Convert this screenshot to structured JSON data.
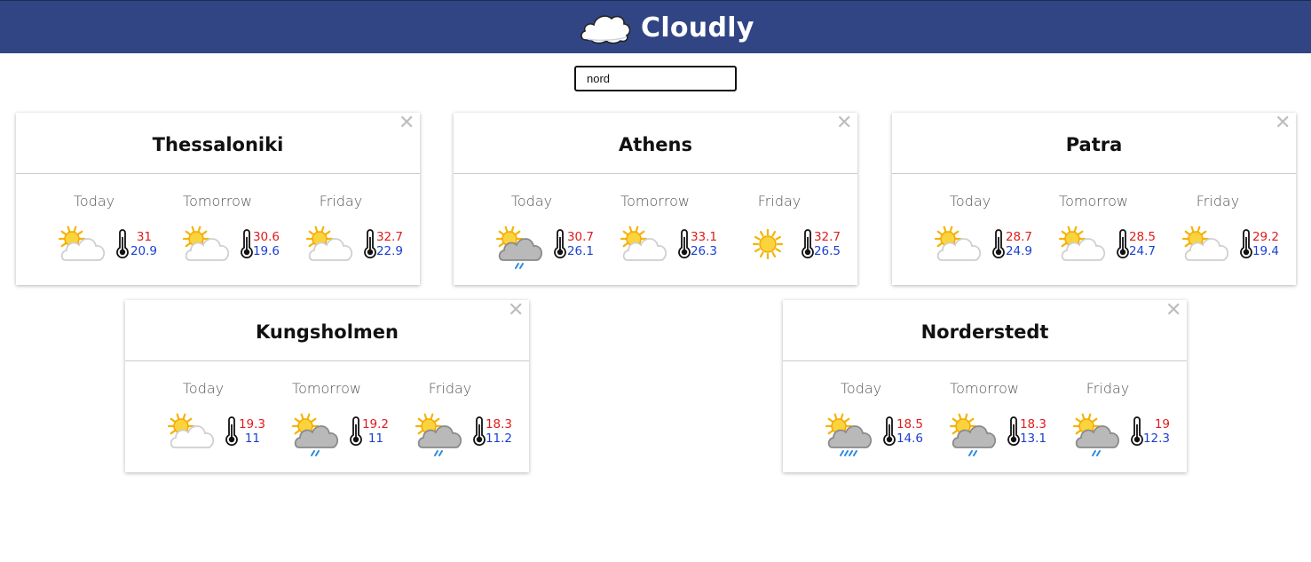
{
  "app": {
    "title": "Cloudly"
  },
  "search": {
    "value": "nord"
  },
  "colors": {
    "header": "#314585",
    "high_temp": "#e01b1b",
    "low_temp": "#1b3fd0"
  },
  "cards": [
    {
      "city": "Thessaloniki",
      "days": [
        {
          "label": "Today",
          "icon": "partly-cloudy-icon",
          "high": "31",
          "low": "20.9"
        },
        {
          "label": "Tomorrow",
          "icon": "partly-cloudy-icon",
          "high": "30.6",
          "low": "19.6"
        },
        {
          "label": "Friday",
          "icon": "partly-cloudy-icon",
          "high": "32.7",
          "low": "22.9"
        }
      ]
    },
    {
      "city": "Athens",
      "days": [
        {
          "label": "Today",
          "icon": "light-rain-icon",
          "high": "30.7",
          "low": "26.1"
        },
        {
          "label": "Tomorrow",
          "icon": "partly-cloudy-icon",
          "high": "33.1",
          "low": "26.3"
        },
        {
          "label": "Friday",
          "icon": "sunny-icon",
          "high": "32.7",
          "low": "26.5"
        }
      ]
    },
    {
      "city": "Patra",
      "days": [
        {
          "label": "Today",
          "icon": "partly-cloudy-icon",
          "high": "28.7",
          "low": "24.9"
        },
        {
          "label": "Tomorrow",
          "icon": "partly-cloudy-icon",
          "high": "28.5",
          "low": "24.7"
        },
        {
          "label": "Friday",
          "icon": "partly-cloudy-icon",
          "high": "29.2",
          "low": "19.4"
        }
      ]
    },
    {
      "city": "Kungsholmen",
      "days": [
        {
          "label": "Today",
          "icon": "partly-cloudy-icon",
          "high": "19.3",
          "low": "11"
        },
        {
          "label": "Tomorrow",
          "icon": "light-rain-icon",
          "high": "19.2",
          "low": "11"
        },
        {
          "label": "Friday",
          "icon": "light-rain-icon",
          "high": "18.3",
          "low": "11.2"
        }
      ]
    },
    {
      "city": "Norderstedt",
      "days": [
        {
          "label": "Today",
          "icon": "rain-icon",
          "high": "18.5",
          "low": "14.6"
        },
        {
          "label": "Tomorrow",
          "icon": "light-rain-icon",
          "high": "18.3",
          "low": "13.1"
        },
        {
          "label": "Friday",
          "icon": "light-rain-icon",
          "high": "19",
          "low": "12.3"
        }
      ]
    }
  ]
}
